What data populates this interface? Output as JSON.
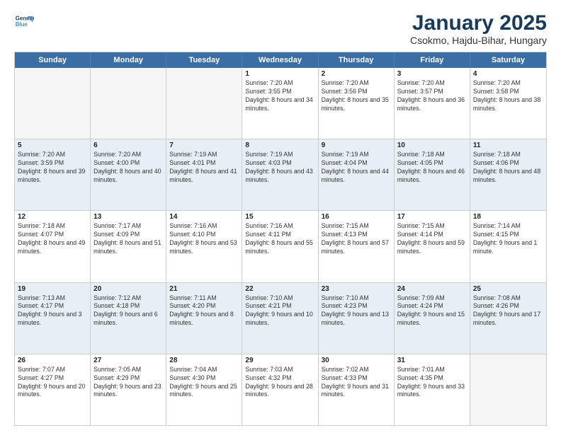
{
  "logo": {
    "line1": "General",
    "line2": "Blue"
  },
  "title": "January 2025",
  "location": "Csokmo, Hajdu-Bihar, Hungary",
  "days": [
    "Sunday",
    "Monday",
    "Tuesday",
    "Wednesday",
    "Thursday",
    "Friday",
    "Saturday"
  ],
  "weeks": [
    [
      {
        "num": "",
        "empty": true
      },
      {
        "num": "",
        "empty": true
      },
      {
        "num": "",
        "empty": true
      },
      {
        "num": "1",
        "rise": "7:20 AM",
        "set": "3:55 PM",
        "daylight": "8 hours and 34 minutes."
      },
      {
        "num": "2",
        "rise": "7:20 AM",
        "set": "3:56 PM",
        "daylight": "8 hours and 35 minutes."
      },
      {
        "num": "3",
        "rise": "7:20 AM",
        "set": "3:57 PM",
        "daylight": "8 hours and 36 minutes."
      },
      {
        "num": "4",
        "rise": "7:20 AM",
        "set": "3:58 PM",
        "daylight": "8 hours and 38 minutes."
      }
    ],
    [
      {
        "num": "5",
        "rise": "7:20 AM",
        "set": "3:59 PM",
        "daylight": "8 hours and 39 minutes."
      },
      {
        "num": "6",
        "rise": "7:20 AM",
        "set": "4:00 PM",
        "daylight": "8 hours and 40 minutes."
      },
      {
        "num": "7",
        "rise": "7:19 AM",
        "set": "4:01 PM",
        "daylight": "8 hours and 41 minutes."
      },
      {
        "num": "8",
        "rise": "7:19 AM",
        "set": "4:03 PM",
        "daylight": "8 hours and 43 minutes."
      },
      {
        "num": "9",
        "rise": "7:19 AM",
        "set": "4:04 PM",
        "daylight": "8 hours and 44 minutes."
      },
      {
        "num": "10",
        "rise": "7:18 AM",
        "set": "4:05 PM",
        "daylight": "8 hours and 46 minutes."
      },
      {
        "num": "11",
        "rise": "7:18 AM",
        "set": "4:06 PM",
        "daylight": "8 hours and 48 minutes."
      }
    ],
    [
      {
        "num": "12",
        "rise": "7:18 AM",
        "set": "4:07 PM",
        "daylight": "8 hours and 49 minutes."
      },
      {
        "num": "13",
        "rise": "7:17 AM",
        "set": "4:09 PM",
        "daylight": "8 hours and 51 minutes."
      },
      {
        "num": "14",
        "rise": "7:16 AM",
        "set": "4:10 PM",
        "daylight": "8 hours and 53 minutes."
      },
      {
        "num": "15",
        "rise": "7:16 AM",
        "set": "4:11 PM",
        "daylight": "8 hours and 55 minutes."
      },
      {
        "num": "16",
        "rise": "7:15 AM",
        "set": "4:13 PM",
        "daylight": "8 hours and 57 minutes."
      },
      {
        "num": "17",
        "rise": "7:15 AM",
        "set": "4:14 PM",
        "daylight": "8 hours and 59 minutes."
      },
      {
        "num": "18",
        "rise": "7:14 AM",
        "set": "4:15 PM",
        "daylight": "9 hours and 1 minute."
      }
    ],
    [
      {
        "num": "19",
        "rise": "7:13 AM",
        "set": "4:17 PM",
        "daylight": "9 hours and 3 minutes."
      },
      {
        "num": "20",
        "rise": "7:12 AM",
        "set": "4:18 PM",
        "daylight": "9 hours and 6 minutes."
      },
      {
        "num": "21",
        "rise": "7:11 AM",
        "set": "4:20 PM",
        "daylight": "9 hours and 8 minutes."
      },
      {
        "num": "22",
        "rise": "7:10 AM",
        "set": "4:21 PM",
        "daylight": "9 hours and 10 minutes."
      },
      {
        "num": "23",
        "rise": "7:10 AM",
        "set": "4:23 PM",
        "daylight": "9 hours and 13 minutes."
      },
      {
        "num": "24",
        "rise": "7:09 AM",
        "set": "4:24 PM",
        "daylight": "9 hours and 15 minutes."
      },
      {
        "num": "25",
        "rise": "7:08 AM",
        "set": "4:26 PM",
        "daylight": "9 hours and 17 minutes."
      }
    ],
    [
      {
        "num": "26",
        "rise": "7:07 AM",
        "set": "4:27 PM",
        "daylight": "9 hours and 20 minutes."
      },
      {
        "num": "27",
        "rise": "7:05 AM",
        "set": "4:29 PM",
        "daylight": "9 hours and 23 minutes."
      },
      {
        "num": "28",
        "rise": "7:04 AM",
        "set": "4:30 PM",
        "daylight": "9 hours and 25 minutes."
      },
      {
        "num": "29",
        "rise": "7:03 AM",
        "set": "4:32 PM",
        "daylight": "9 hours and 28 minutes."
      },
      {
        "num": "30",
        "rise": "7:02 AM",
        "set": "4:33 PM",
        "daylight": "9 hours and 31 minutes."
      },
      {
        "num": "31",
        "rise": "7:01 AM",
        "set": "4:35 PM",
        "daylight": "9 hours and 33 minutes."
      },
      {
        "num": "",
        "empty": true
      }
    ]
  ]
}
